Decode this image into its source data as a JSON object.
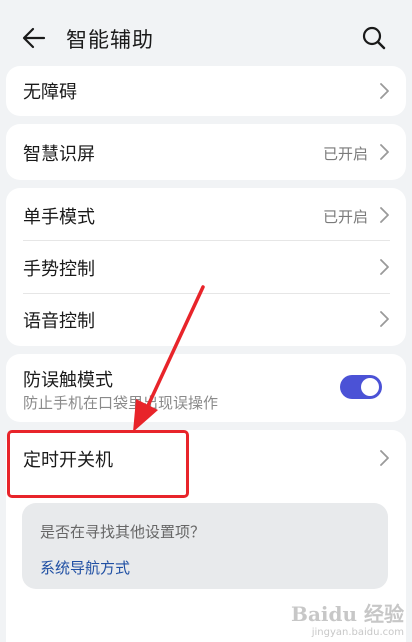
{
  "header": {
    "title": "智能辅助"
  },
  "card1": {
    "item": {
      "label": "无障碍"
    }
  },
  "card2": {
    "item": {
      "label": "智慧识屏",
      "value": "已开启"
    }
  },
  "card3": {
    "items": [
      {
        "label": "单手模式",
        "value": "已开启"
      },
      {
        "label": "手势控制"
      },
      {
        "label": "语音控制"
      }
    ]
  },
  "card4": {
    "label": "防误触模式",
    "sublabel": "防止手机在口袋里出现误操作",
    "toggle_on": true,
    "toggle_color": "#4b52d6"
  },
  "card5": {
    "item": {
      "label": "定时开关机"
    }
  },
  "suggestion": {
    "question": "是否在寻找其他设置项？",
    "link": "系统导航方式"
  },
  "annotation": {
    "color": "#e8242a"
  },
  "watermark": {
    "logo": "Baidu 经验",
    "url": "jingyan.baidu.com"
  },
  "icons": {
    "back": "arrow-left-icon",
    "search": "search-icon",
    "chevron": "chevron-right-icon"
  }
}
